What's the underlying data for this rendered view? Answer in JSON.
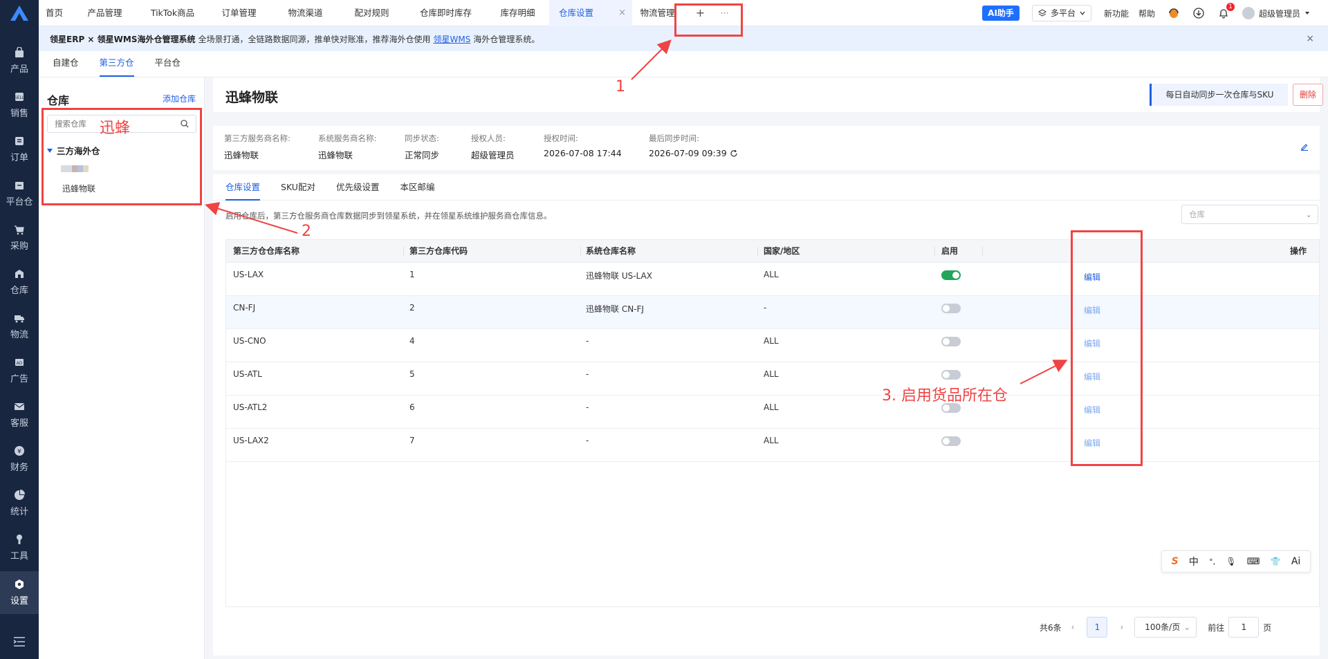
{
  "topbar": {
    "tabs": [
      {
        "label": "首页"
      },
      {
        "label": "产品管理"
      },
      {
        "label": "TikTok商品"
      },
      {
        "label": "订单管理"
      },
      {
        "label": "物流渠道"
      },
      {
        "label": "配对规则"
      },
      {
        "label": "仓库即时库存"
      },
      {
        "label": "库存明细"
      },
      {
        "label": "仓库设置",
        "active": true
      },
      {
        "label": "物流管理"
      }
    ],
    "add_label": "+",
    "more_label": "···",
    "close_glyph": "×",
    "ai_label": "AI助手",
    "platform_label": "多平台",
    "new_feature_label": "新功能",
    "help_label": "帮助",
    "notification_count": "1",
    "user_name": "超级管理员"
  },
  "sidenav": {
    "items": [
      {
        "label": "产品",
        "icon": "product-icon"
      },
      {
        "label": "销售",
        "icon": "sale-icon"
      },
      {
        "label": "订单",
        "icon": "order-icon"
      },
      {
        "label": "平台仓",
        "icon": "platform-warehouse-icon"
      },
      {
        "label": "采购",
        "icon": "cart-icon"
      },
      {
        "label": "仓库",
        "icon": "warehouse-icon"
      },
      {
        "label": "物流",
        "icon": "truck-icon"
      },
      {
        "label": "广告",
        "icon": "ad-icon"
      },
      {
        "label": "客服",
        "icon": "mail-icon"
      },
      {
        "label": "财务",
        "icon": "finance-icon"
      },
      {
        "label": "统计",
        "icon": "pie-icon"
      },
      {
        "label": "工具",
        "icon": "tool-icon"
      },
      {
        "label": "设置",
        "icon": "settings-icon",
        "active": true
      }
    ]
  },
  "banner": {
    "title": "领星ERP × 领星WMS海外仓管理系统",
    "text": "全场景打通，全链路数据同源，推单快对账准，推荐海外仓使用",
    "link": "领星WMS",
    "tail": "海外仓管理系统。",
    "close": "×"
  },
  "subtabs": [
    {
      "label": "自建仓"
    },
    {
      "label": "第三方仓",
      "active": true
    },
    {
      "label": "平台仓"
    }
  ],
  "tree": {
    "title": "仓库",
    "add_label": "添加仓库",
    "search_placeholder": "搜索仓库",
    "group_label": "三方海外仓",
    "leaf_label": "迅蜂物联"
  },
  "header": {
    "title": "迅蜂物联",
    "sync_label": "每日自动同步一次仓库与SKU",
    "delete_label": "删除"
  },
  "info": [
    {
      "label": "第三方服务商名称:",
      "value": "迅蜂物联"
    },
    {
      "label": "系统服务商名称:",
      "value": "迅蜂物联"
    },
    {
      "label": "同步状态:",
      "value": "正常同步"
    },
    {
      "label": "授权人员:",
      "value": "超级管理员"
    },
    {
      "label": "授权时间:",
      "value": "2026-07-08 17:44"
    },
    {
      "label": "最后同步时间:",
      "value": "2026-07-09 09:39"
    }
  ],
  "inner_tabs": [
    {
      "label": "仓库设置",
      "active": true
    },
    {
      "label": "SKU配对"
    },
    {
      "label": "优先级设置"
    },
    {
      "label": "本区邮编"
    }
  ],
  "hint": "启用仓库后，第三方仓服务商仓库数据同步到领星系统，并在领星系统维护服务商仓库信息。",
  "warehouse_select_placeholder": "仓库",
  "table": {
    "columns": [
      "第三方仓仓库名称",
      "第三方仓库代码",
      "系统仓库名称",
      "国家/地区",
      "启用",
      "操作"
    ],
    "rows": [
      {
        "name": "US-LAX",
        "code": "1",
        "sys_name": "迅蜂物联 US-LAX",
        "region": "ALL",
        "enabled": true,
        "op": "编辑"
      },
      {
        "name": "CN-FJ",
        "code": "2",
        "sys_name": "迅蜂物联 CN-FJ",
        "region": "-",
        "enabled": false,
        "op": "编辑"
      },
      {
        "name": "US-CNO",
        "code": "4",
        "sys_name": "-",
        "region": "ALL",
        "enabled": false,
        "op": "编辑"
      },
      {
        "name": "US-ATL",
        "code": "5",
        "sys_name": "-",
        "region": "ALL",
        "enabled": false,
        "op": "编辑"
      },
      {
        "name": "US-ATL2",
        "code": "6",
        "sys_name": "-",
        "region": "ALL",
        "enabled": false,
        "op": "编辑"
      },
      {
        "name": "US-LAX2",
        "code": "7",
        "sys_name": "-",
        "region": "ALL",
        "enabled": false,
        "op": "编辑"
      }
    ]
  },
  "pager": {
    "total": "共6条",
    "current": "1",
    "page_size": "100条/页",
    "goto_prefix": "前往",
    "goto_value": "1",
    "goto_suffix": "页"
  },
  "ime": {
    "items": [
      "S",
      "中",
      "°,",
      "🎙",
      "⌨",
      "👕",
      "Ai"
    ]
  },
  "annotations": {
    "label_1": "1",
    "label_2": "2",
    "label_3": "3. 启用货品所在仓",
    "search_overlay": "迅蜂",
    "color": "#f04343"
  },
  "colors": {
    "accent": "#1f5fe0",
    "nav_bg": "#18263f",
    "toggle_on": "#22a559",
    "danger": "#e53935"
  }
}
